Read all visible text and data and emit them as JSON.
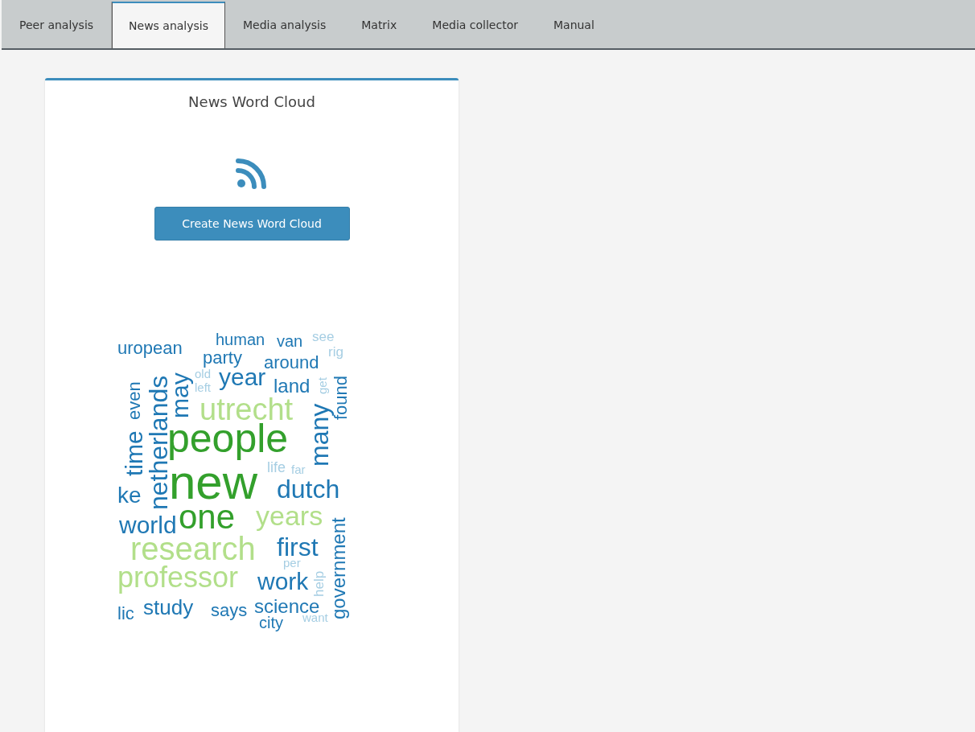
{
  "tabs": [
    {
      "label": "Peer analysis",
      "selected": false
    },
    {
      "label": "News analysis",
      "selected": true
    },
    {
      "label": "Media analysis",
      "selected": false
    },
    {
      "label": "Matrix",
      "selected": false
    },
    {
      "label": "Media collector",
      "selected": false
    },
    {
      "label": "Manual",
      "selected": false
    }
  ],
  "card": {
    "title": "News Word Cloud",
    "button": "Create News Word Cloud",
    "word_cloud": [
      {
        "text": "uropean",
        "color": "#1f78b4",
        "vertical": false
      },
      {
        "text": "human",
        "color": "#1f78b4",
        "vertical": false
      },
      {
        "text": "van",
        "color": "#1f78b4",
        "vertical": false
      },
      {
        "text": "see",
        "color": "#a6cee3",
        "vertical": false
      },
      {
        "text": "rig",
        "color": "#a6cee3",
        "vertical": false
      },
      {
        "text": "party",
        "color": "#1f78b4",
        "vertical": false
      },
      {
        "text": "around",
        "color": "#1f78b4",
        "vertical": false
      },
      {
        "text": "old",
        "color": "#a6cee3",
        "vertical": false
      },
      {
        "text": "left",
        "color": "#a6cee3",
        "vertical": false
      },
      {
        "text": "year",
        "color": "#1f78b4",
        "vertical": false
      },
      {
        "text": "land",
        "color": "#1f78b4",
        "vertical": false
      },
      {
        "text": "utrecht",
        "color": "#b2df8a",
        "vertical": false
      },
      {
        "text": "people",
        "color": "#33a02c",
        "vertical": false
      },
      {
        "text": "new",
        "color": "#33a02c",
        "vertical": false
      },
      {
        "text": "dutch",
        "color": "#1f78b4",
        "vertical": false
      },
      {
        "text": "life",
        "color": "#a6cee3",
        "vertical": false
      },
      {
        "text": "far",
        "color": "#a6cee3",
        "vertical": false
      },
      {
        "text": "ke",
        "color": "#1f78b4",
        "vertical": false
      },
      {
        "text": "world",
        "color": "#1f78b4",
        "vertical": false
      },
      {
        "text": "one",
        "color": "#33a02c",
        "vertical": false
      },
      {
        "text": "years",
        "color": "#b2df8a",
        "vertical": false
      },
      {
        "text": "research",
        "color": "#b2df8a",
        "vertical": false
      },
      {
        "text": "first",
        "color": "#1f78b4",
        "vertical": false
      },
      {
        "text": "professor",
        "color": "#b2df8a",
        "vertical": false
      },
      {
        "text": "per",
        "color": "#a6cee3",
        "vertical": false
      },
      {
        "text": "work",
        "color": "#1f78b4",
        "vertical": false
      },
      {
        "text": "study",
        "color": "#1f78b4",
        "vertical": false
      },
      {
        "text": "says",
        "color": "#1f78b4",
        "vertical": false
      },
      {
        "text": "science",
        "color": "#1f78b4",
        "vertical": false
      },
      {
        "text": "lic",
        "color": "#1f78b4",
        "vertical": false
      },
      {
        "text": "city",
        "color": "#1f78b4",
        "vertical": false
      },
      {
        "text": "want",
        "color": "#a6cee3",
        "vertical": false
      },
      {
        "text": "even",
        "color": "#1f78b4",
        "vertical": true
      },
      {
        "text": "time",
        "color": "#1f78b4",
        "vertical": true
      },
      {
        "text": "netherlands",
        "color": "#1f78b4",
        "vertical": true
      },
      {
        "text": "may",
        "color": "#1f78b4",
        "vertical": true
      },
      {
        "text": "get",
        "color": "#a6cee3",
        "vertical": true
      },
      {
        "text": "found",
        "color": "#1f78b4",
        "vertical": true
      },
      {
        "text": "many",
        "color": "#1f78b4",
        "vertical": true
      },
      {
        "text": "help",
        "color": "#a6cee3",
        "vertical": true
      },
      {
        "text": "government",
        "color": "#1f78b4",
        "vertical": true
      }
    ]
  }
}
